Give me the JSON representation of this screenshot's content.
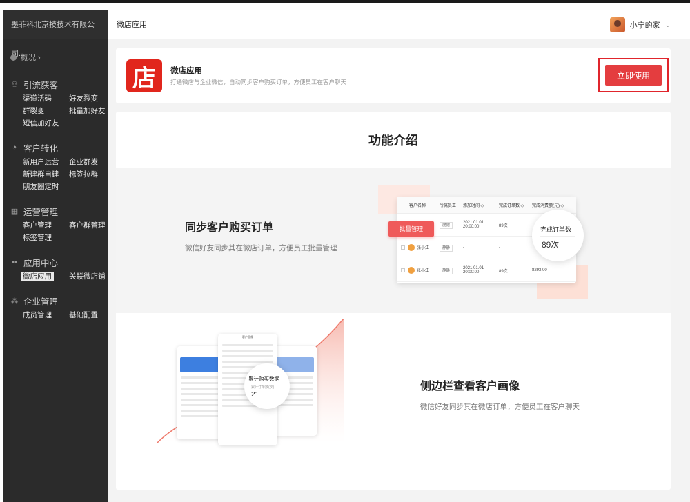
{
  "sidebar": {
    "company": "墨菲科北京技技术有限公司...",
    "overview": "概况 ›",
    "groups": [
      {
        "title": "引流获客",
        "icon": "person-icon",
        "items": [
          "渠道活码",
          "好友裂变",
          "群裂变",
          "批量加好友",
          "短信加好友"
        ]
      },
      {
        "title": "客户转化",
        "icon": "cycle-icon",
        "items": [
          "新用户运营",
          "企业群发",
          "新建群自建",
          "标签拉群",
          "朋友圈定时"
        ]
      },
      {
        "title": "运营管理",
        "icon": "chart-icon",
        "items": [
          "客户管理",
          "客户群管理",
          "标签管理"
        ]
      },
      {
        "title": "应用中心",
        "icon": "grid-icon",
        "items": [
          "微店应用",
          "关联微店铺"
        ]
      },
      {
        "title": "企业管理",
        "icon": "org-icon",
        "items": [
          "成员管理",
          "基础配置"
        ]
      }
    ],
    "active_item": "微店应用"
  },
  "header": {
    "title": "微店应用",
    "user_name": "小宁的家"
  },
  "app": {
    "logo_char": "店",
    "name": "微店应用",
    "description": "打通微店与企业微信，自动同步客户购买订单，方便员工在客户聊天",
    "use_button": "立即使用"
  },
  "intro": {
    "title": "功能介绍",
    "feature1": {
      "title": "同步客户购买订单",
      "desc": "微信好友同步其在微店订单，方便员工批量管理",
      "table_headers": [
        "客户名称",
        "所属员工",
        "添加时间 ◇",
        "完成订单数 ◇",
        "完成消费额(元) ◇"
      ],
      "rows": [
        [
          "",
          "虎虎",
          "2021.01.01 20:00:00",
          "89次",
          ""
        ],
        [
          "张小江",
          "静静",
          "-",
          "-",
          ""
        ],
        [
          "张小江",
          "静静",
          "2021.01.01 20:00:00",
          "89次",
          "8293.00"
        ]
      ],
      "batch_label": "批量管理",
      "bubble_label": "完成订单数",
      "bubble_value": "89次"
    },
    "feature2": {
      "title": "侧边栏查看客户画像",
      "desc": "微信好友同步其在微店订单，方便员工在客户聊天",
      "bubble_label": "累计购买数据",
      "bubble_sub": "累计订单数(次)",
      "bubble_value": "21",
      "phone_title": "客户画像"
    }
  },
  "colors": {
    "accent": "#e43d3f",
    "highlight_frame": "#e0252c",
    "sidebar_bg": "#2b2b2b"
  }
}
